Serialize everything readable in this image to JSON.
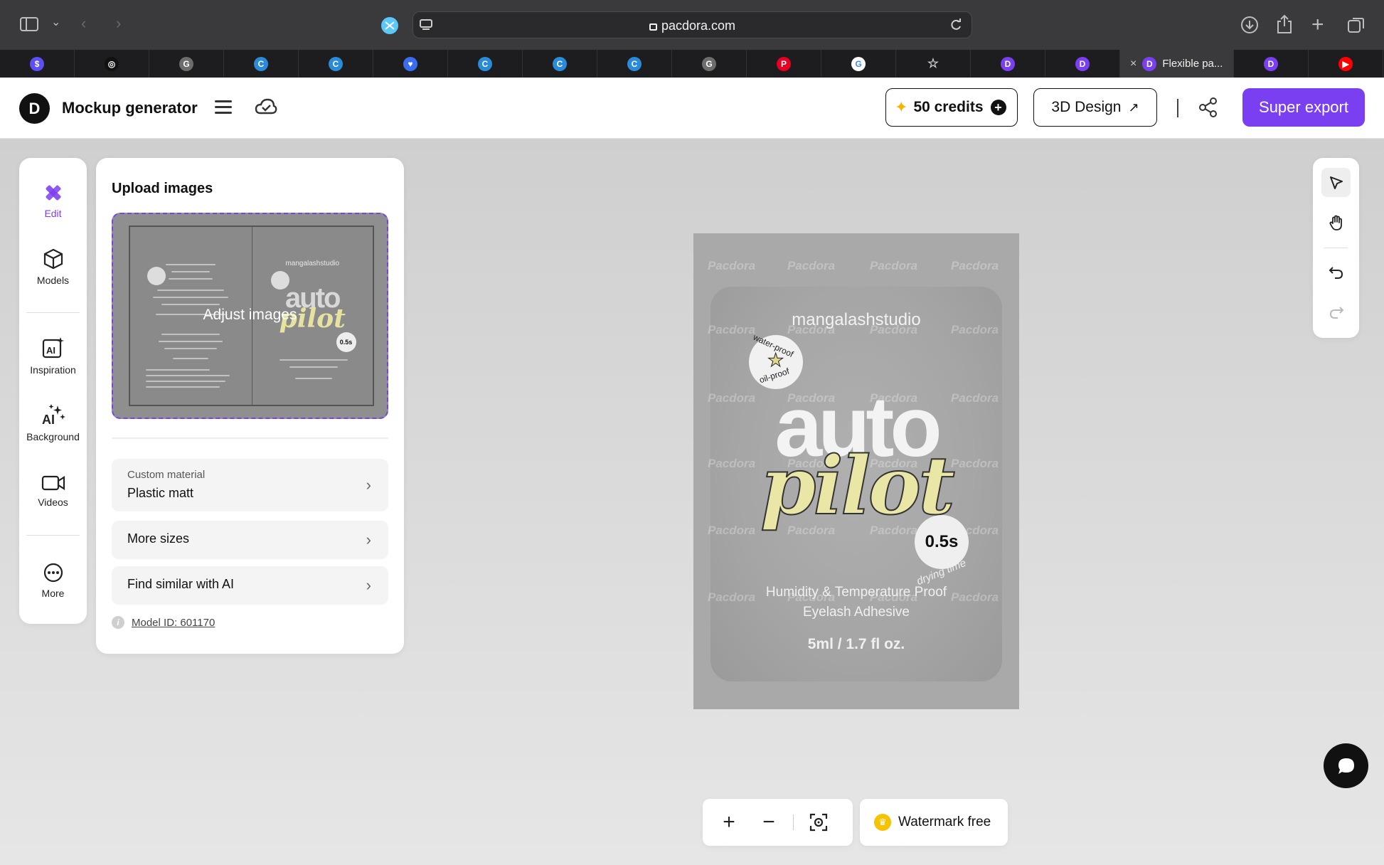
{
  "browser": {
    "url": "pacdora.com",
    "active_tab_title": "Flexible pa..."
  },
  "tabs": [
    {
      "icon": "dollar-favicon",
      "color": "#5b4ff5",
      "glyph": "$"
    },
    {
      "icon": "openai-favicon",
      "color": "#111111",
      "glyph": "◎"
    },
    {
      "icon": "g-favicon",
      "color": "#6d6d6d",
      "glyph": "G"
    },
    {
      "icon": "canva-favicon",
      "color": "#2a8bd8",
      "glyph": "C"
    },
    {
      "icon": "canva-favicon",
      "color": "#2a8bd8",
      "glyph": "C"
    },
    {
      "icon": "heart-favicon",
      "color": "#3b6df0",
      "glyph": "♥"
    },
    {
      "icon": "canva-favicon",
      "color": "#2a8bd8",
      "glyph": "C"
    },
    {
      "icon": "canva-favicon",
      "color": "#2a8bd8",
      "glyph": "C"
    },
    {
      "icon": "canva-favicon",
      "color": "#2a8bd8",
      "glyph": "C"
    },
    {
      "icon": "g-favicon",
      "color": "#6d6d6d",
      "glyph": "G"
    },
    {
      "icon": "pinterest-favicon",
      "color": "#e60023",
      "glyph": "P"
    },
    {
      "icon": "google-favicon",
      "color": "#ffffff",
      "glyph": "G"
    },
    {
      "icon": "star-favicon",
      "color": "#1d1d1f",
      "glyph": "☆"
    },
    {
      "icon": "pacdora-favicon",
      "color": "#7b3ff2",
      "glyph": "D"
    },
    {
      "icon": "pacdora-favicon",
      "color": "#7b3ff2",
      "glyph": "D"
    },
    {
      "icon": "pacdora-favicon",
      "color": "#7b3ff2",
      "glyph": "D"
    },
    {
      "icon": "pacdora-favicon",
      "color": "#7b3ff2",
      "glyph": "D"
    },
    {
      "icon": "youtube-favicon",
      "color": "#ff0000",
      "glyph": "▶"
    }
  ],
  "header": {
    "app_title": "Mockup generator",
    "credits_label": "50 credits",
    "design_label": "3D Design",
    "export_label": "Super export",
    "accent": "#7b3ff2"
  },
  "rail": {
    "items": [
      {
        "label": "Edit",
        "icon": "edit-icon"
      },
      {
        "label": "Models",
        "icon": "cube-icon"
      },
      {
        "label": "Inspiration",
        "icon": "ai-image-icon"
      },
      {
        "label": "Background",
        "icon": "ai-sparkle-icon"
      },
      {
        "label": "Videos",
        "icon": "video-icon"
      },
      {
        "label": "More",
        "icon": "more-icon"
      }
    ]
  },
  "panel": {
    "title": "Upload images",
    "adjust_label": "Adjust images",
    "preview": {
      "brand": "mangalashstudio",
      "auto": "auto",
      "pilot": "pilot",
      "badge": "0.5s"
    },
    "material_label": "Custom material",
    "material_value": "Plastic matt",
    "more_sizes": "More sizes",
    "find_similar": "Find similar with AI",
    "model_id": "Model ID: 601170"
  },
  "pouch": {
    "brand": "mangalashstudio",
    "word1": "auto",
    "word2": "pilot",
    "stamp_top": "water-proof",
    "stamp_bottom": "oil-proof",
    "badge": "0.5s",
    "badge_sub": "drying time",
    "desc_line1": "Humidity & Temperature Proof",
    "desc_line2": "Eyelash Adhesive",
    "volume": "5ml / 1.7 fl oz.",
    "watermark": "Pacdora"
  },
  "bottom": {
    "zoom_in": "+",
    "zoom_out": "−",
    "watermark_label": "Watermark free"
  }
}
